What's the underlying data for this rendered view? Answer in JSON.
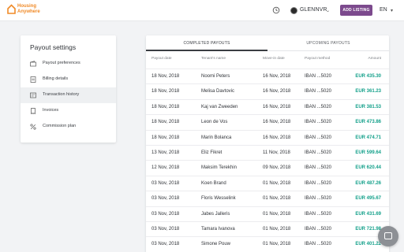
{
  "brand": {
    "line1": "Housing",
    "line2": "Anywhere",
    "color": "#f08a27"
  },
  "header": {
    "username": "GLENNVR",
    "add_listing": "ADD LISTING",
    "language": "EN",
    "accent": "#7c4a8d",
    "icons": [
      "history-icon",
      "avatar",
      "chevron-down-icon"
    ]
  },
  "sidebar": {
    "title": "Payout settings",
    "items": [
      {
        "label": "Payout preferences",
        "icon": "wallet-icon",
        "active": false
      },
      {
        "label": "Billing details",
        "icon": "document-icon",
        "active": false
      },
      {
        "label": "Transaction history",
        "icon": "transactions-icon",
        "active": true
      },
      {
        "label": "Invoices",
        "icon": "invoice-icon",
        "active": false
      },
      {
        "label": "Commission plan",
        "icon": "percent-icon",
        "active": false
      }
    ]
  },
  "tabs": [
    {
      "label": "COMPLETED PAYOUTS",
      "active": true
    },
    {
      "label": "UPCOMING PAYOUTS",
      "active": false
    }
  ],
  "table": {
    "columns": [
      "Payout date",
      "Tenant's name",
      "Move-in date",
      "Payout method",
      "Amount"
    ],
    "rows": [
      [
        "18 Nov, 2018",
        "Noomi Peters",
        "16 Nov, 2018",
        "IBAN ...5020",
        "EUR 435.30"
      ],
      [
        "18 Nov, 2018",
        "Melisa Davtovic",
        "16 Nov, 2018",
        "IBAN ...5020",
        "EUR 361.23"
      ],
      [
        "18 Nov, 2018",
        "Kaj van Zweeden",
        "16 Nov, 2018",
        "IBAN ...5020",
        "EUR 381.53"
      ],
      [
        "18 Nov, 2018",
        "Leon de Vos",
        "16 Nov, 2018",
        "IBAN ...5020",
        "EUR 473.86"
      ],
      [
        "18 Nov, 2018",
        "Marin Bolanca",
        "16 Nov, 2018",
        "IBAN ...5020",
        "EUR 474.71"
      ],
      [
        "13 Nov, 2018",
        "Eliz Fikret",
        "11 Nov, 2018",
        "IBAN ...5020",
        "EUR 599.64"
      ],
      [
        "12 Nov, 2018",
        "Maksim Terekhin",
        "09 Nov, 2018",
        "IBAN ...5020",
        "EUR 620.44"
      ],
      [
        "03 Nov, 2018",
        "Koen Brand",
        "01 Nov, 2018",
        "IBAN ...5020",
        "EUR 487.26"
      ],
      [
        "03 Nov, 2018",
        "Floris Wesselink",
        "01 Nov, 2018",
        "IBAN ...5020",
        "EUR 495.67"
      ],
      [
        "03 Nov, 2018",
        "Jabes Jalleris",
        "01 Nov, 2018",
        "IBAN ...5020",
        "EUR 431.69"
      ],
      [
        "03 Nov, 2018",
        "Tamara Ivanova",
        "01 Nov, 2018",
        "IBAN ...5020",
        "EUR 721.98"
      ],
      [
        "03 Nov, 2018",
        "Simone Pouw",
        "01 Nov, 2018",
        "IBAN ...5020",
        "EUR 401.22"
      ]
    ],
    "amount_color": "#13a08a"
  },
  "chat_icon": "chat-icon"
}
